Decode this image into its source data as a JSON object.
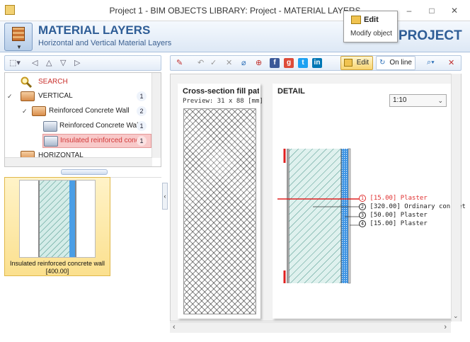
{
  "window": {
    "title": "Project 1 -  BIM OBJECTS LIBRARY: Project - MATERIAL LAYERS",
    "controls": [
      "–",
      "□",
      "✕"
    ]
  },
  "header": {
    "title": "MATERIAL LAYERS",
    "subtitle": "Horizontal and Vertical Material Layers",
    "right_label": "PROJECT"
  },
  "tooltip": {
    "title": "Edit",
    "description": "Modify object"
  },
  "tree": {
    "search_label": "SEARCH",
    "items": [
      {
        "label": "VERTICAL",
        "count": "1"
      },
      {
        "label": "Reinforced Concrete Wall",
        "count": "2"
      },
      {
        "label": "Reinforced Concrete Wall",
        "count": "1"
      },
      {
        "label": "Insulated reinforced conc",
        "count": "1"
      },
      {
        "label": "HORIZONTAL",
        "count": ""
      }
    ]
  },
  "thumbnail": {
    "caption_line1": "Insulated reinforced concrete wall",
    "caption_line2": "[400.00]"
  },
  "toolbar": {
    "edit_label": "Edit",
    "online_label": "On line"
  },
  "cross_section": {
    "title": "Cross-section fill pat",
    "preview_label": "Preview: 31 x 88 [mm]"
  },
  "detail": {
    "title": "DETAIL",
    "scale": "1:10",
    "layers": [
      {
        "num": "1",
        "text": "[15.00] Plaster",
        "color": "#e03030"
      },
      {
        "num": "2",
        "text": "[320.00] Ordinary concret",
        "color": "#222222"
      },
      {
        "num": "3",
        "text": "[50.00] Plaster",
        "color": "#222222"
      },
      {
        "num": "4",
        "text": "[15.00] Plaster",
        "color": "#222222"
      }
    ]
  },
  "colors": {
    "accent": "#2e5d96",
    "selection": "#f8c9c9",
    "highlight": "#fbe08e"
  }
}
